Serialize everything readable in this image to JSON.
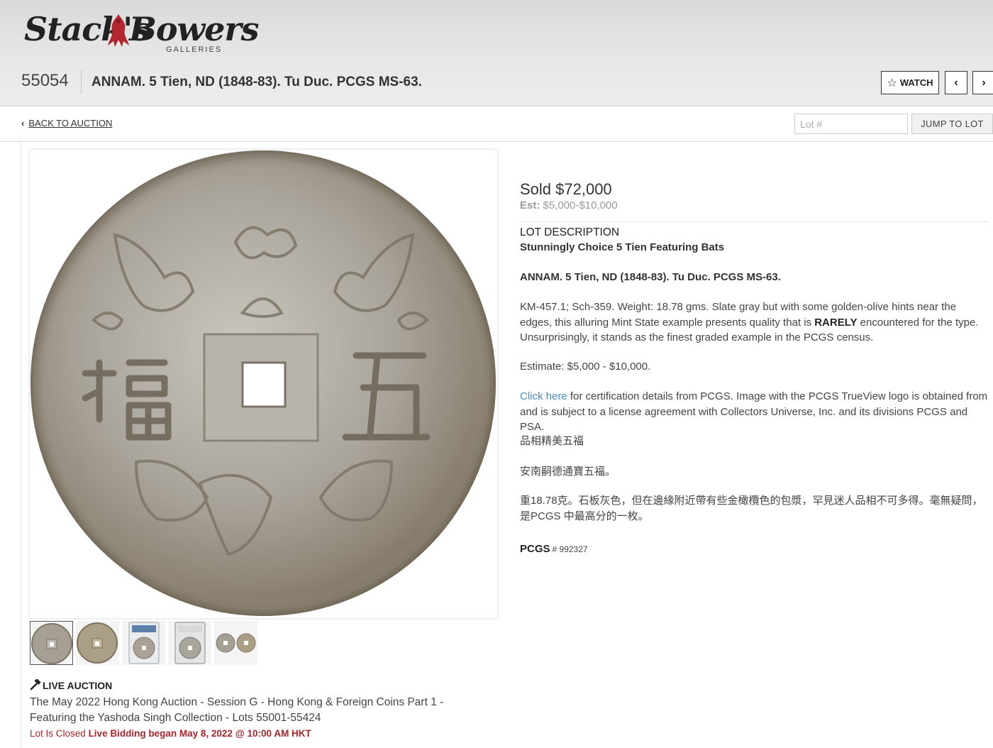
{
  "brand": {
    "logo_left": "Stack's",
    "logo_right": "Bowers",
    "logo_sub": "GALLERIES"
  },
  "lot": {
    "number": "55054",
    "title": "ANNAM. 5 Tien, ND (1848-83). Tu Duc. PCGS MS-63."
  },
  "toolbar": {
    "watch_label": "WATCH",
    "prev_glyph": "‹",
    "next_glyph": "›"
  },
  "nav": {
    "back_label": "BACK TO AUCTION",
    "lot_input_placeholder": "Lot #",
    "jump_label": "JUMP TO LOT"
  },
  "gallery": {
    "thumbnail_count": 5,
    "active_index": 0
  },
  "auction": {
    "type_label": "LIVE AUCTION",
    "name": "The May 2022 Hong Kong Auction - Session G - Hong Kong & Foreign Coins Part 1 - Featuring the Yashoda Singh Collection - Lots 55001-55424",
    "status_closed": "Lot Is Closed",
    "status_bidding": "Live Bidding began May 8, 2022 @ 10:00 AM HKT"
  },
  "price": {
    "sold": "Sold $72,000",
    "est_label": "Est:",
    "est_value": "$5,000-$10,000"
  },
  "description": {
    "section_label": "LOT DESCRIPTION",
    "headline": "Stunningly Choice 5 Tien Featuring Bats",
    "title": "ANNAM. 5 Tien, ND (1848-83). Tu Duc. PCGS MS-63.",
    "p1_before": "KM-457.1; Sch-359. Weight: 18.78 gms. Slate gray but with some golden-olive hints near the edges, this alluring Mint State example presents quality that is ",
    "p1_bold": "RARELY",
    "p1_after": " encountered for the type. Unsurprisingly, it stands as the finest graded example in the PCGS census.",
    "estimate": "Estimate: $5,000 - $10,000.",
    "p3_link": "Click here",
    "p3_rest": " for certification details from PCGS. Image with the PCGS TrueView logo is obtained from and is subject to a license agreement with Collectors Universe, Inc. and its divisions PCGS and PSA.",
    "cn_headline": "品相精美五福",
    "cn_title": "安南嗣德通寶五福。",
    "cn_body": "重18.78克。石板灰色，但在邊緣附近帶有些金橄欖色的包漿，罕見迷人品相不可多得。毫無疑問，是PCGS 中最高分的一枚。",
    "pcgs_label": "PCGS",
    "pcgs_number": "# 992327"
  },
  "colors": {
    "accent_red": "#a8262b",
    "link_blue": "#4a8bc4"
  }
}
